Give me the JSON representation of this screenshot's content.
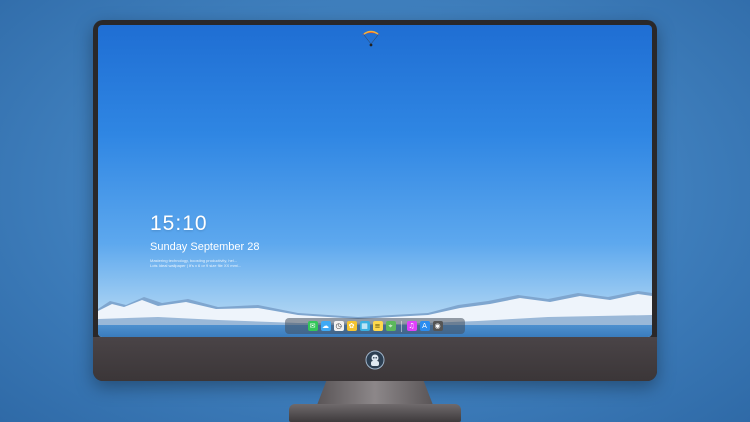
{
  "lockscreen": {
    "time": "15:10",
    "date": "Sunday September 28",
    "note_line1": "Mastering technology, boosting productivity, hel...",
    "note_line2": "Lots Ideal wallpaper | It's x 6 or 9 size file XX mm/..."
  },
  "dock": {
    "apps": [
      {
        "icon": "messages-icon",
        "color": "#34c759",
        "glyph": "✉"
      },
      {
        "icon": "weather-icon",
        "color": "#3fa9f5",
        "glyph": "☁"
      },
      {
        "icon": "clock-icon",
        "color": "#f2f2f2",
        "glyph": "◷"
      },
      {
        "icon": "photos-icon",
        "color": "#f4c430",
        "glyph": "✿"
      },
      {
        "icon": "clapper-icon",
        "color": "#3ab0e0",
        "glyph": "▦"
      },
      {
        "icon": "notes-icon",
        "color": "#ffd84d",
        "glyph": "≡"
      },
      {
        "icon": "maps-icon",
        "color": "#5cb85c",
        "glyph": "⌖"
      },
      {
        "icon": "music-icon",
        "color": "#e040fb",
        "glyph": "♫"
      },
      {
        "icon": "app-store-icon",
        "color": "#2b8cf0",
        "glyph": "A"
      },
      {
        "icon": "camera-icon",
        "color": "#555555",
        "glyph": "◉"
      }
    ]
  },
  "colors": {
    "bezel": "#2a2829",
    "chin": "#433e40",
    "sky_top": "#1f6ed3",
    "background": "#3f7fbd"
  }
}
